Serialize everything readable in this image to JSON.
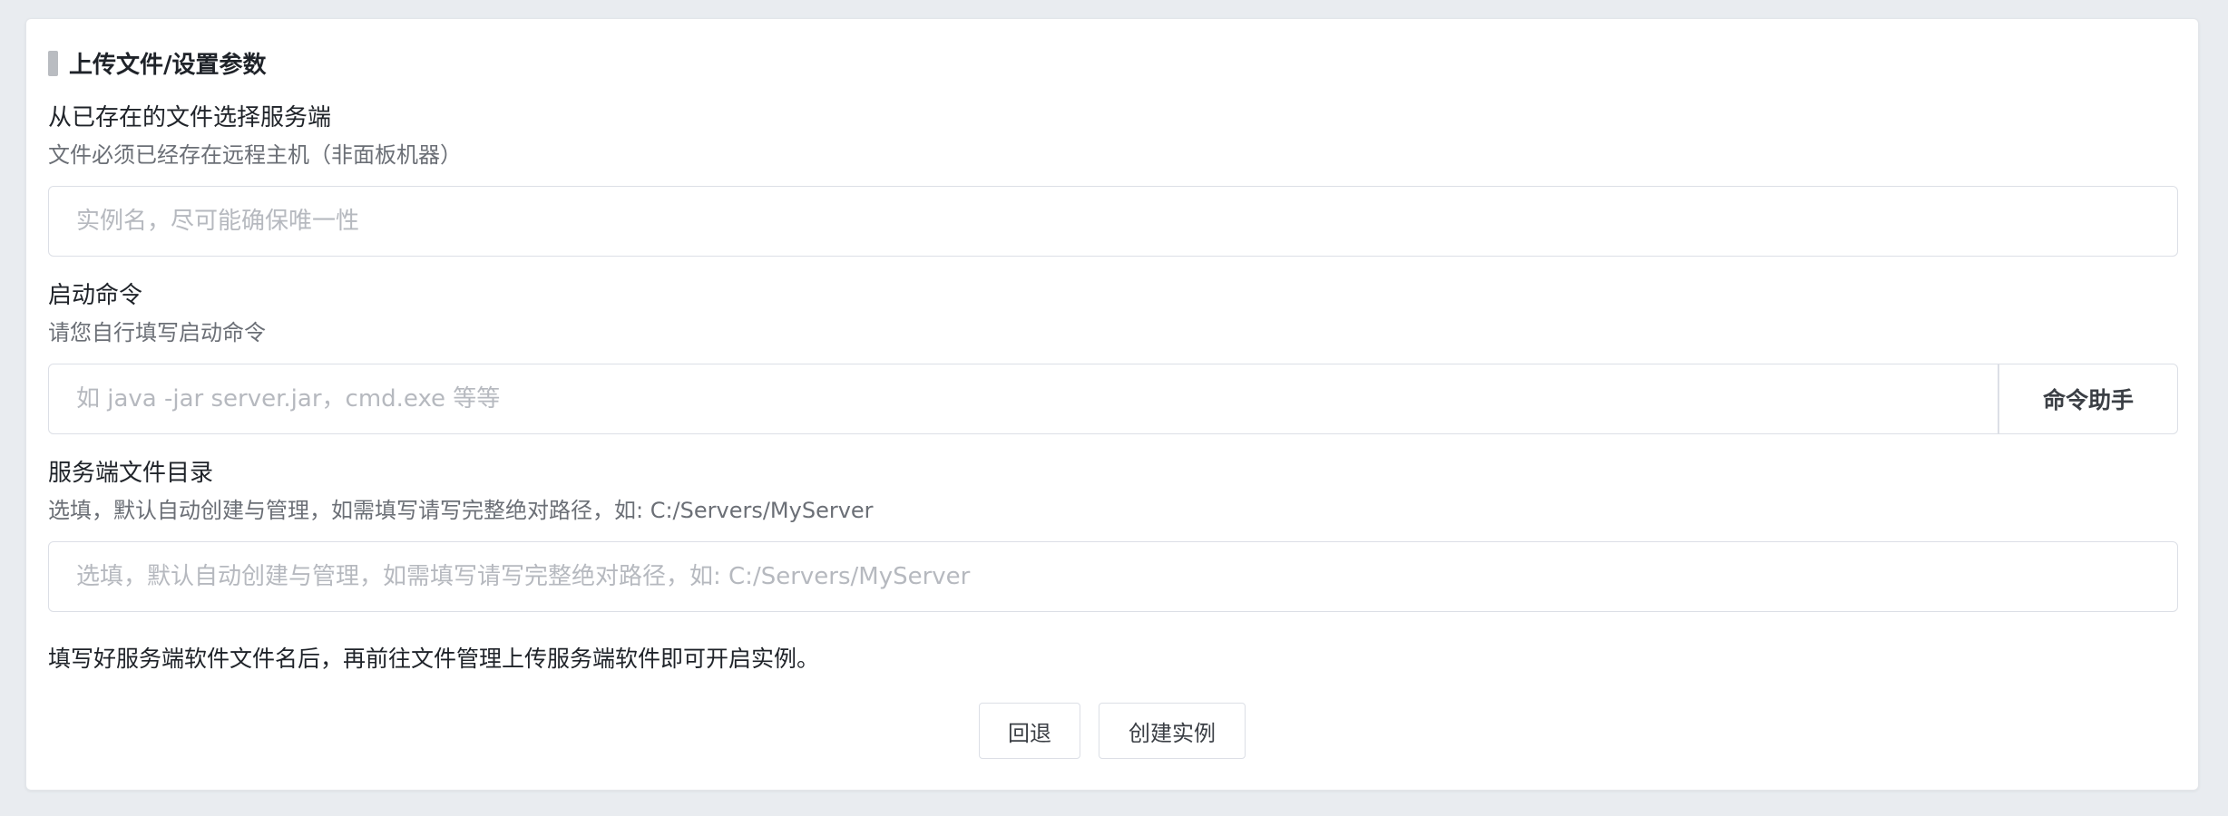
{
  "section": {
    "title": "上传文件/设置参数"
  },
  "fields": [
    {
      "label": "从已存在的文件选择服务端",
      "description": "文件必须已经存在远程主机（非面板机器）",
      "placeholder": "实例名，尽可能确保唯一性",
      "value": ""
    },
    {
      "label": "启动命令",
      "description": "请您自行填写启动命令",
      "placeholder": "如 java -jar server.jar，cmd.exe 等等",
      "value": "",
      "append_button": "命令助手"
    },
    {
      "label": "服务端文件目录",
      "description": "选填，默认自动创建与管理，如需填写请写完整绝对路径，如: C:/Servers/MyServer",
      "placeholder": "选填，默认自动创建与管理，如需填写请写完整绝对路径，如: C:/Servers/MyServer",
      "value": ""
    }
  ],
  "note": "填写好服务端软件文件名后，再前往文件管理上传服务端软件即可开启实例。",
  "actions": {
    "back_label": "回退",
    "create_label": "创建实例"
  }
}
